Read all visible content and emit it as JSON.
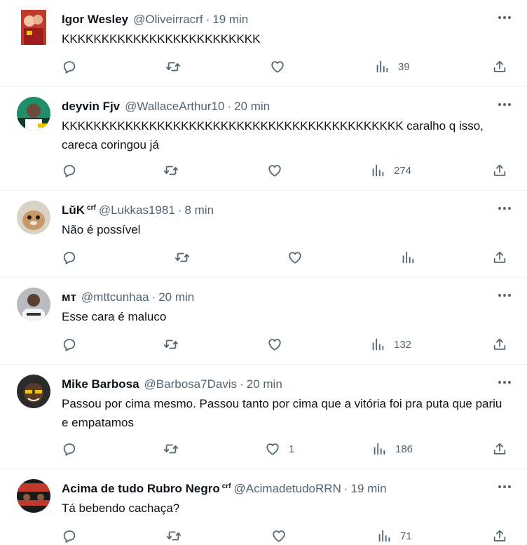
{
  "tweets": [
    {
      "name": "Igor Wesley",
      "badge": "",
      "handle": "@Oliveirracrf",
      "time": "19 min",
      "text": "KKKKKKKKKKKKKKKKKKKKKKKKK",
      "reply_count": "",
      "retweet_count": "",
      "like_count": "",
      "view_count": "39"
    },
    {
      "name": "deyvin Fjv",
      "badge": "",
      "handle": "@WallaceArthur10",
      "time": "20 min",
      "text": "KKKKKKKKKKKKKKKKKKKKKKKKKKKKKKKKKKKKKKKKKKK caralho q isso, careca coringou já",
      "reply_count": "",
      "retweet_count": "",
      "like_count": "",
      "view_count": "274"
    },
    {
      "name": "LŭK",
      "badge": "crf",
      "handle": "@Lukkas1981",
      "time": "8 min",
      "text": "Não é possível",
      "reply_count": "",
      "retweet_count": "",
      "like_count": "",
      "view_count": ""
    },
    {
      "name": "ᴍᴛ",
      "badge": "",
      "handle": "@mttcunhaa",
      "time": "20 min",
      "text": "Esse cara é maluco",
      "reply_count": "",
      "retweet_count": "",
      "like_count": "",
      "view_count": "132"
    },
    {
      "name": "Mike Barbosa",
      "badge": "",
      "handle": "@Barbosa7Davis",
      "time": "20 min",
      "text": "Passou por cima mesmo. Passou tanto por cima que a vitória foi pra puta que pariu e empatamos",
      "reply_count": "",
      "retweet_count": "",
      "like_count": "1",
      "view_count": "186"
    },
    {
      "name": "Acima de tudo Rubro Negro",
      "badge": "crf",
      "handle": "@AcimadetudoRRN",
      "time": "19 min",
      "text": "Tá bebendo cachaça?",
      "reply_count": "",
      "retweet_count": "",
      "like_count": "",
      "view_count": "71"
    }
  ],
  "separator": "·",
  "icons": [
    "more-icon",
    "reply-icon",
    "retweet-icon",
    "like-icon",
    "views-icon",
    "share-icon"
  ],
  "colors": {
    "text": "#0f1419",
    "secondary": "#536471",
    "divider": "#eff3f4"
  }
}
